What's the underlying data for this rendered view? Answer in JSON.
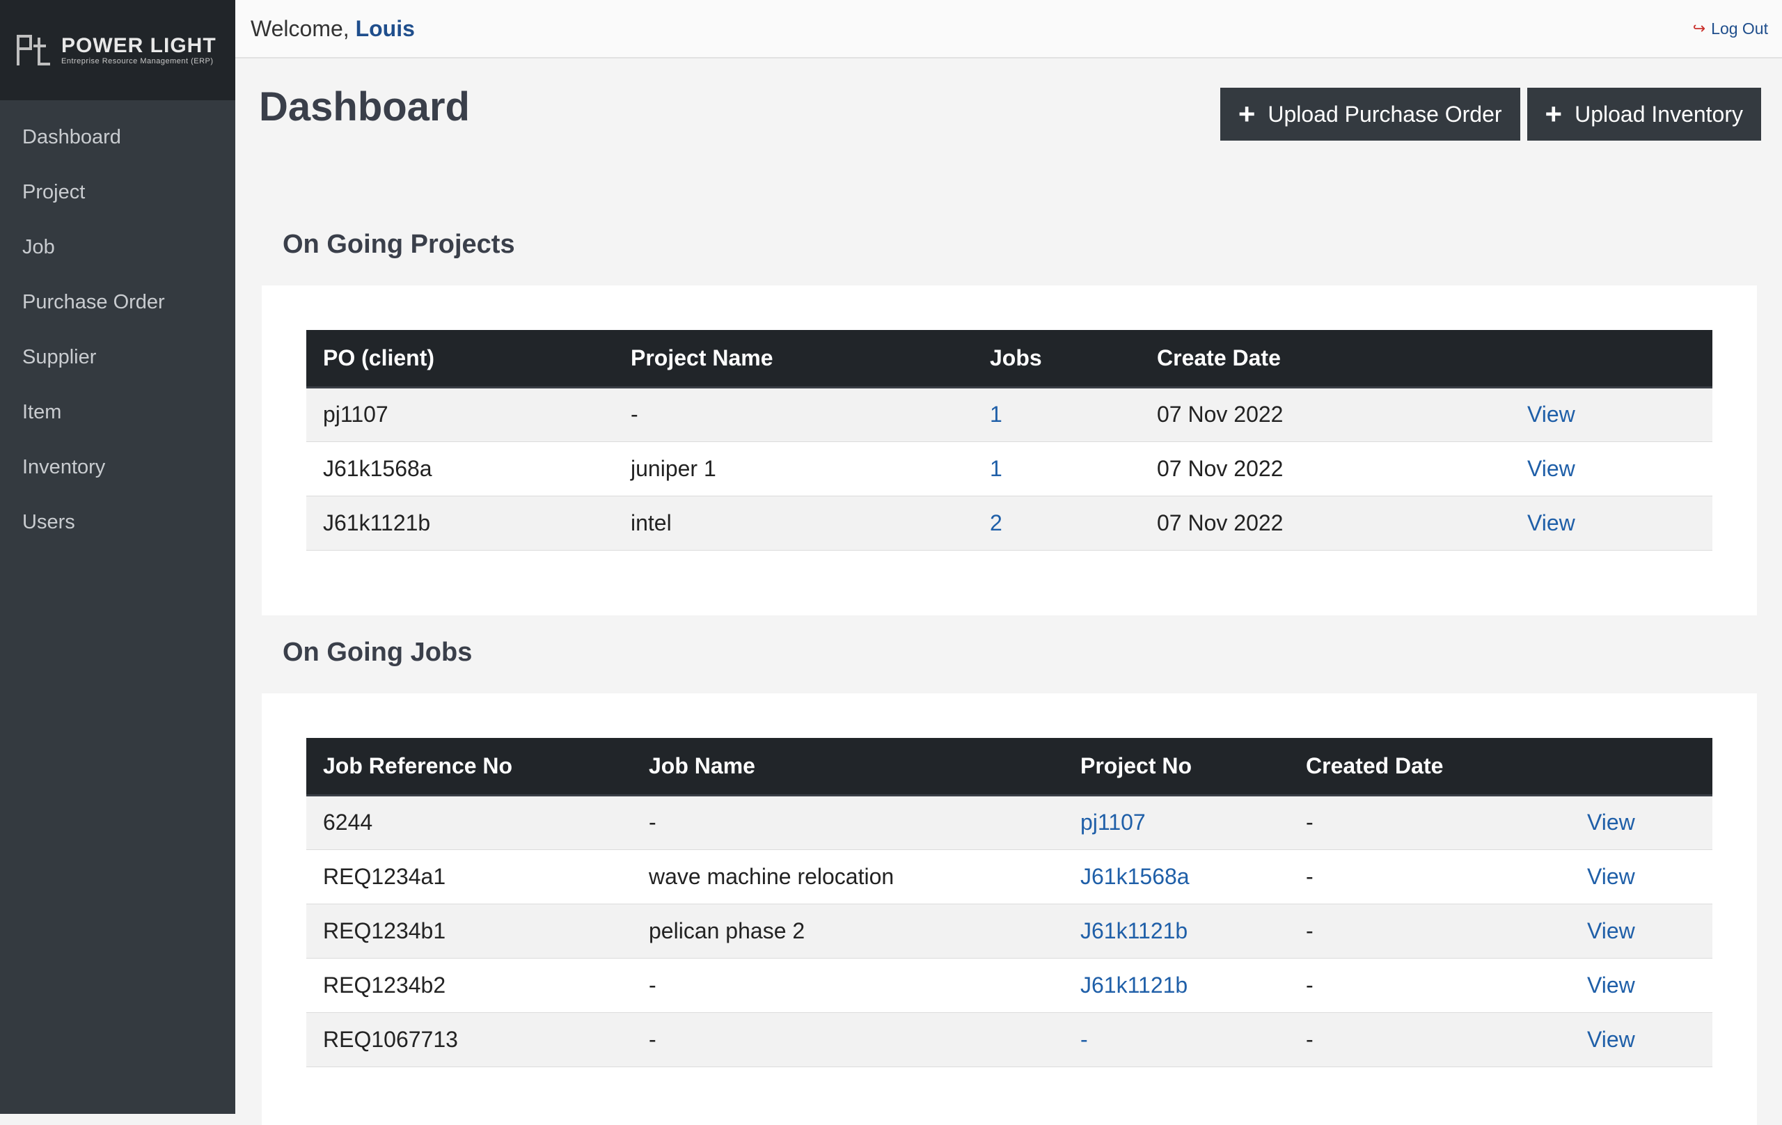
{
  "brand": {
    "title": "POWER LIGHT",
    "subtitle": "Entreprise Resource Management (ERP)",
    "logo_letters": "Pt"
  },
  "sidebar": {
    "items": [
      {
        "label": "Dashboard"
      },
      {
        "label": "Project"
      },
      {
        "label": "Job"
      },
      {
        "label": "Purchase Order"
      },
      {
        "label": "Supplier"
      },
      {
        "label": "Item"
      },
      {
        "label": "Inventory"
      },
      {
        "label": "Users"
      }
    ]
  },
  "header": {
    "welcome_prefix": "Welcome, ",
    "user_name": "Louis",
    "logout_label": "Log Out",
    "logout_icon": "sign-out-icon"
  },
  "main": {
    "title": "Dashboard",
    "upload_po_label": "Upload Purchase Order",
    "upload_inventory_label": "Upload Inventory"
  },
  "projects": {
    "title": "On Going Projects",
    "columns": [
      "PO (client)",
      "Project Name",
      "Jobs",
      "Create Date",
      ""
    ],
    "rows": [
      {
        "po": "pj1107",
        "name": "-",
        "jobs": "1",
        "date": "07 Nov 2022",
        "action": "View"
      },
      {
        "po": "J61k1568a",
        "name": "juniper 1",
        "jobs": "1",
        "date": "07 Nov 2022",
        "action": "View"
      },
      {
        "po": "J61k1121b",
        "name": "intel",
        "jobs": "2",
        "date": "07 Nov 2022",
        "action": "View"
      }
    ]
  },
  "jobs": {
    "title": "On Going Jobs",
    "columns": [
      "Job Reference No",
      "Job Name",
      "Project No",
      "Created Date",
      ""
    ],
    "rows": [
      {
        "ref": "6244",
        "name": "-",
        "project": "pj1107",
        "date": "-",
        "action": "View"
      },
      {
        "ref": "REQ1234a1",
        "name": "wave machine relocation",
        "project": "J61k1568a",
        "date": "-",
        "action": "View"
      },
      {
        "ref": "REQ1234b1",
        "name": "pelican phase 2",
        "project": "J61k1121b",
        "date": "-",
        "action": "View"
      },
      {
        "ref": "REQ1234b2",
        "name": "-",
        "project": "J61k1121b",
        "date": "-",
        "action": "View"
      },
      {
        "ref": "REQ1067713",
        "name": "-",
        "project": "-",
        "date": "-",
        "action": "View"
      }
    ]
  },
  "colors": {
    "sidebar_bg": "#343a40",
    "brand_bg": "#212529",
    "link": "#1f5fa8",
    "table_header": "#212529"
  }
}
